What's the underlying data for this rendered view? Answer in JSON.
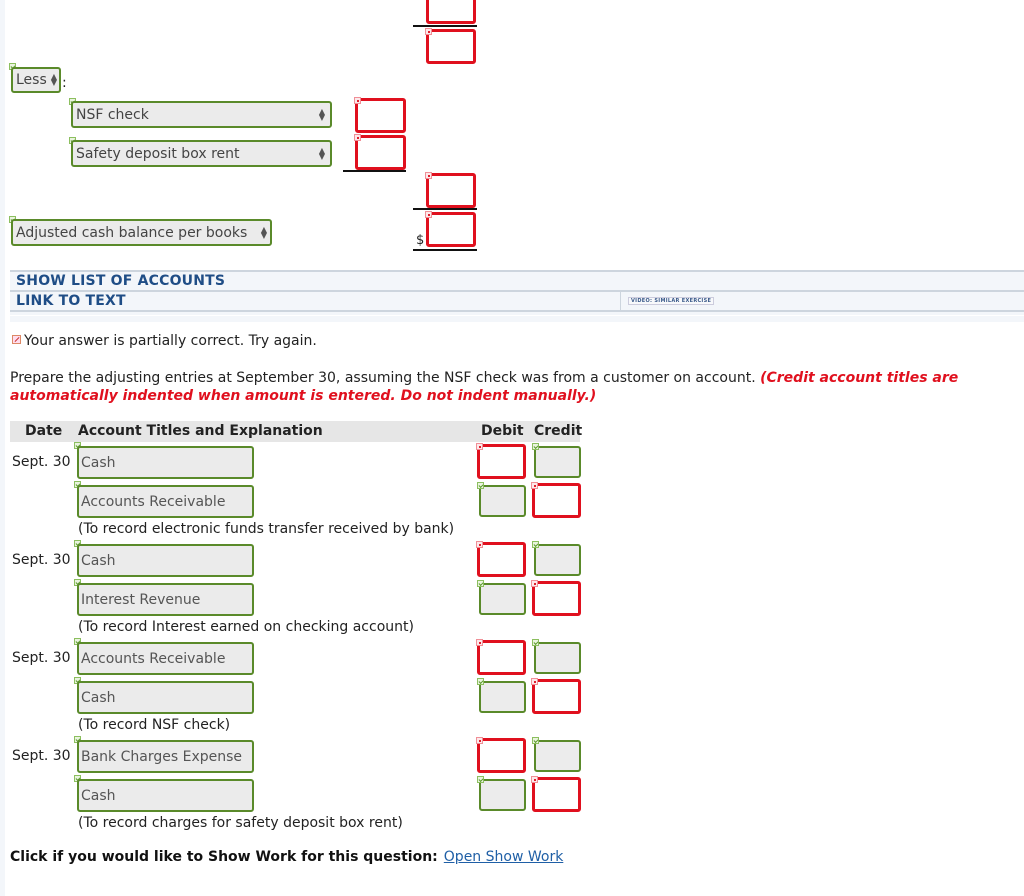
{
  "reconciliation": {
    "less_select": "Less",
    "less_colon": ":",
    "deductions": [
      {
        "label": "NSF check",
        "amount": ""
      },
      {
        "label": "Safety deposit box rent",
        "amount": ""
      }
    ],
    "adjusted_select": "Adjusted cash balance per books",
    "dollar_sign": "$"
  },
  "toolbar": {
    "show_list_of_accounts": "SHOW LIST OF ACCOUNTS",
    "link_to_text": "LINK TO TEXT",
    "video_similar_exercise": "VIDEO: SIMILAR EXERCISE"
  },
  "feedback": {
    "message": "Your answer is partially correct.  Try again."
  },
  "instructions": {
    "text": "Prepare the adjusting entries at September 30, assuming the NSF check was from a customer on account. ",
    "note": "(Credit account titles are automatically indented when amount is entered. Do not indent manually.)"
  },
  "journal": {
    "headers": {
      "date": "Date",
      "account": "Account Titles and Explanation",
      "debit": "Debit",
      "credit": "Credit"
    },
    "entries": [
      {
        "date": "Sept. 30",
        "debit_account": "Cash",
        "credit_account": "Accounts Receivable",
        "explanation": "(To record electronic funds transfer received by bank)"
      },
      {
        "date": "Sept. 30",
        "debit_account": "Cash",
        "credit_account": "Interest Revenue",
        "explanation": "(To record Interest earned on checking account)"
      },
      {
        "date": "Sept. 30",
        "debit_account": "Accounts Receivable",
        "credit_account": "Cash",
        "explanation": "(To record NSF check)"
      },
      {
        "date": "Sept. 30",
        "debit_account": "Bank Charges Expense",
        "credit_account": "Cash",
        "explanation": "(To record charges for safety deposit box rent)"
      }
    ]
  },
  "show_work": {
    "prompt": "Click if you would like to Show Work for this question:",
    "link": "Open Show Work"
  },
  "colors": {
    "error_red": "#e0101e",
    "correct_green": "#5a8a2a",
    "link_blue": "#1f5fa6"
  }
}
